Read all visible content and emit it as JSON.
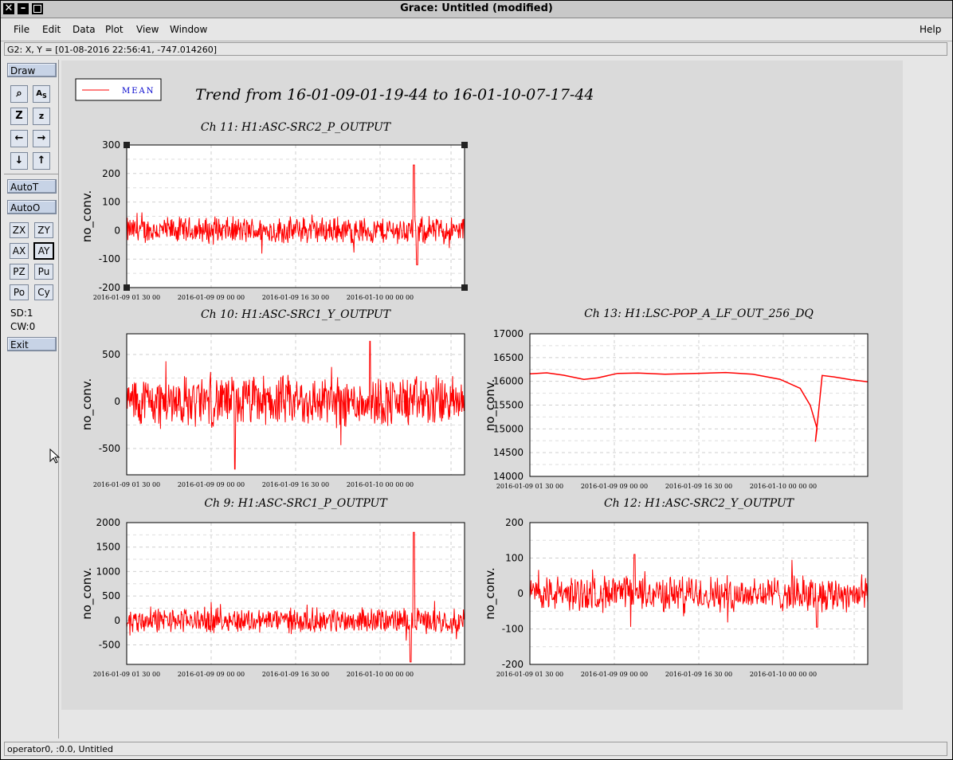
{
  "window": {
    "title": "Grace: Untitled (modified)"
  },
  "menu": {
    "file": "File",
    "edit": "Edit",
    "data": "Data",
    "plot": "Plot",
    "view": "View",
    "window": "Window",
    "help": "Help"
  },
  "locator": "G2: X, Y = [01-08-2016 22:56:41, -747.014260]",
  "toolbar": {
    "draw": "Draw",
    "autot": "AutoT",
    "autoo": "AutoO",
    "zx": "ZX",
    "zy": "ZY",
    "ax": "AX",
    "ay": "AY",
    "pz": "PZ",
    "pu": "Pu",
    "po": "Po",
    "cy": "Cy",
    "sd": "SD:1",
    "cw": "CW:0",
    "exit": "Exit",
    "icons": [
      "zoom-icon",
      "autoscale-icon",
      "zoom-x-icon",
      "zoom-y-icon",
      "arrow-left-icon",
      "arrow-right-icon",
      "arrow-down-icon",
      "arrow-up-icon"
    ]
  },
  "status": "operator0, :0.0, Untitled",
  "plot": {
    "main_title": "Trend from 16-01-09-01-19-44 to 16-01-10-07-17-44",
    "legend_label": "MEAN",
    "series_color": "#ff0000",
    "legend_text_color": "#0000cc"
  },
  "chart_data": [
    {
      "type": "line",
      "title": "Ch 11: H1:ASC-SRC2_P_OUTPUT",
      "ylabel": "no_conv.",
      "x_tick_labels": [
        "2016-01-09 01:30:00",
        "2016-01-09 09:00:00",
        "2016-01-09 16:30:00",
        "2016-01-10 00:00:00"
      ],
      "y_ticks": [
        -200,
        -100,
        0,
        100,
        200,
        300
      ],
      "ylim": [
        -200,
        300
      ],
      "series": [
        {
          "name": "MEAN",
          "pattern": "noise",
          "amp": 45,
          "baseline": 0,
          "spikes": [
            {
              "x": 0.85,
              "value": 230
            },
            {
              "x": 0.86,
              "value": -120
            }
          ]
        }
      ]
    },
    {
      "type": "line",
      "title": "Ch 10: H1:ASC-SRC1_Y_OUTPUT",
      "ylabel": "no_conv.",
      "x_tick_labels": [
        "2016-01-09 01:30:00",
        "2016-01-09 09:00:00",
        "2016-01-09 16:30:00",
        "2016-01-10 00:00:00"
      ],
      "y_ticks": [
        -500,
        0,
        500
      ],
      "ylim": [
        -780,
        720
      ],
      "series": [
        {
          "name": "MEAN",
          "pattern": "noise",
          "amp": 260,
          "baseline": 0,
          "spikes": [
            {
              "x": 0.32,
              "value": -720
            },
            {
              "x": 0.72,
              "value": 640
            }
          ]
        }
      ]
    },
    {
      "type": "line",
      "title": "Ch 13: H1:LSC-POP_A_LF_OUT_256_DQ",
      "ylabel": "no_conv.",
      "x_tick_labels": [
        "2016-01-09 01:30:00",
        "2016-01-09 09:00:00",
        "2016-01-09 16:30:00",
        "2016-01-10 00:00:00"
      ],
      "y_ticks": [
        14000,
        14500,
        15000,
        15500,
        16000,
        16500,
        17000
      ],
      "ylim": [
        14000,
        17000
      ],
      "series": [
        {
          "name": "MEAN",
          "pattern": "smooth",
          "points": [
            [
              0.0,
              16150
            ],
            [
              0.05,
              16170
            ],
            [
              0.1,
              16120
            ],
            [
              0.16,
              16050
            ],
            [
              0.2,
              16080
            ],
            [
              0.26,
              16160
            ],
            [
              0.32,
              16180
            ],
            [
              0.4,
              16150
            ],
            [
              0.5,
              16160
            ],
            [
              0.58,
              16180
            ],
            [
              0.66,
              16150
            ],
            [
              0.74,
              16050
            ],
            [
              0.8,
              15850
            ],
            [
              0.83,
              15500
            ],
            [
              0.85,
              15000
            ],
            [
              0.845,
              14720
            ],
            [
              0.855,
              15400
            ],
            [
              0.865,
              16120
            ],
            [
              0.9,
              16090
            ],
            [
              0.95,
              16040
            ],
            [
              1.0,
              15990
            ]
          ]
        }
      ]
    },
    {
      "type": "line",
      "title": "Ch 9: H1:ASC-SRC1_P_OUTPUT",
      "ylabel": "no_conv.",
      "x_tick_labels": [
        "2016-01-09 01:30:00",
        "2016-01-09 09:00:00",
        "2016-01-09 16:30:00",
        "2016-01-10 00:00:00"
      ],
      "y_ticks": [
        -500,
        0,
        500,
        1000,
        1500,
        2000
      ],
      "ylim": [
        -900,
        2000
      ],
      "series": [
        {
          "name": "MEAN",
          "pattern": "noise",
          "amp": 240,
          "baseline": 0,
          "spikes": [
            {
              "x": 0.85,
              "value": 1800
            },
            {
              "x": 0.84,
              "value": -850
            }
          ]
        }
      ]
    },
    {
      "type": "line",
      "title": "Ch 12: H1:ASC-SRC2_Y_OUTPUT",
      "ylabel": "no_conv.",
      "x_tick_labels": [
        "2016-01-09 01:30:00",
        "2016-01-09 09:00:00",
        "2016-01-09 16:30:00",
        "2016-01-10 00:00:00"
      ],
      "y_ticks": [
        -200,
        -100,
        0,
        100,
        200
      ],
      "ylim": [
        -200,
        200
      ],
      "series": [
        {
          "name": "MEAN",
          "pattern": "noise",
          "amp": 48,
          "baseline": 0,
          "spikes": [
            {
              "x": 0.31,
              "value": 110
            },
            {
              "x": 0.85,
              "value": -95
            }
          ]
        }
      ]
    }
  ]
}
